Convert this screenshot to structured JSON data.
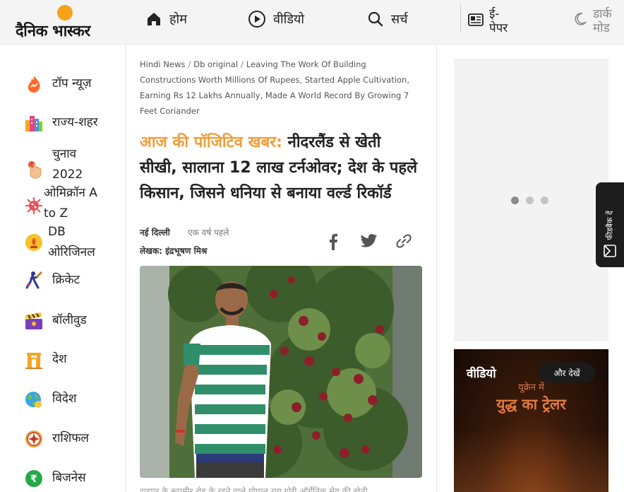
{
  "brand": {
    "name": "दैनिक भास्कर",
    "accent": "#f29c38",
    "sun_color": "#f7a21b"
  },
  "nav": {
    "home_label": "होम",
    "video_label": "वीडियो",
    "search_label": "सर्च",
    "epaper_line1": "ई-",
    "epaper_line2": "पेपर",
    "dark_line1": "डार्क",
    "dark_line2": "मोड"
  },
  "sidebar": {
    "items": [
      {
        "label": "टॉप न्यूज़",
        "icon": "flame-icon"
      },
      {
        "label": "राज्य-शहर",
        "icon": "city-icon"
      },
      {
        "label_line1": "चुनाव",
        "label_line2": "2022",
        "icon": "voting-finger-icon"
      },
      {
        "label_line1": "ओमिक्रॉन A",
        "label_line2": "to Z",
        "icon": "virus-icon"
      },
      {
        "label_line1": "DB",
        "label_line2": "ओरिजिनल",
        "icon": "lamp-icon"
      },
      {
        "label": "क्रिकेट",
        "icon": "cricket-icon"
      },
      {
        "label": "बॉलीवुड",
        "icon": "clapperboard-icon"
      },
      {
        "label": "देश",
        "icon": "india-gate-icon"
      },
      {
        "label": "विदेश",
        "icon": "globe-icon"
      },
      {
        "label": "राशिफल",
        "icon": "zodiac-icon"
      },
      {
        "label": "बिजनेस",
        "icon": "rupee-icon"
      }
    ]
  },
  "breadcrumb": {
    "items": [
      "Hindi News",
      "Db original"
    ],
    "current": "Leaving The Work Of Building Constructions Worth Millions Of Rupees, Started Apple Cultivation, Earning Rs 12 Lakhs Annually, Made A World Record By Growing 7 Feet Coriander"
  },
  "article": {
    "kicker": "आज की पॉजिटिव खबर:",
    "title": "नीदरलैंड से खेती सीखी, सालाना 12 लाख टर्नओवर; देश के पहले किसान, जिसने धनिया से बनाया वर्ल्ड रिकॉर्ड",
    "city": "नई दिल्ली",
    "time_ago": "एक वर्ष पहले",
    "author": "लेखक: इंद्रभूषण मिश्र",
    "caption": "टाहपुर के रूपमीर रोड के रहने वाले गोपाल राय गोरी ऑर्गेनिक सेव की खेती"
  },
  "right": {
    "carousel_dots": 3,
    "active_dot": 1,
    "video_title": "वीडियो",
    "more_label": "और देखें",
    "trailer_line1": "यूक्रेन में",
    "trailer_line2": "युद्ध का ट्रेलर"
  },
  "feedback": {
    "label": "फीडबैक दें"
  }
}
